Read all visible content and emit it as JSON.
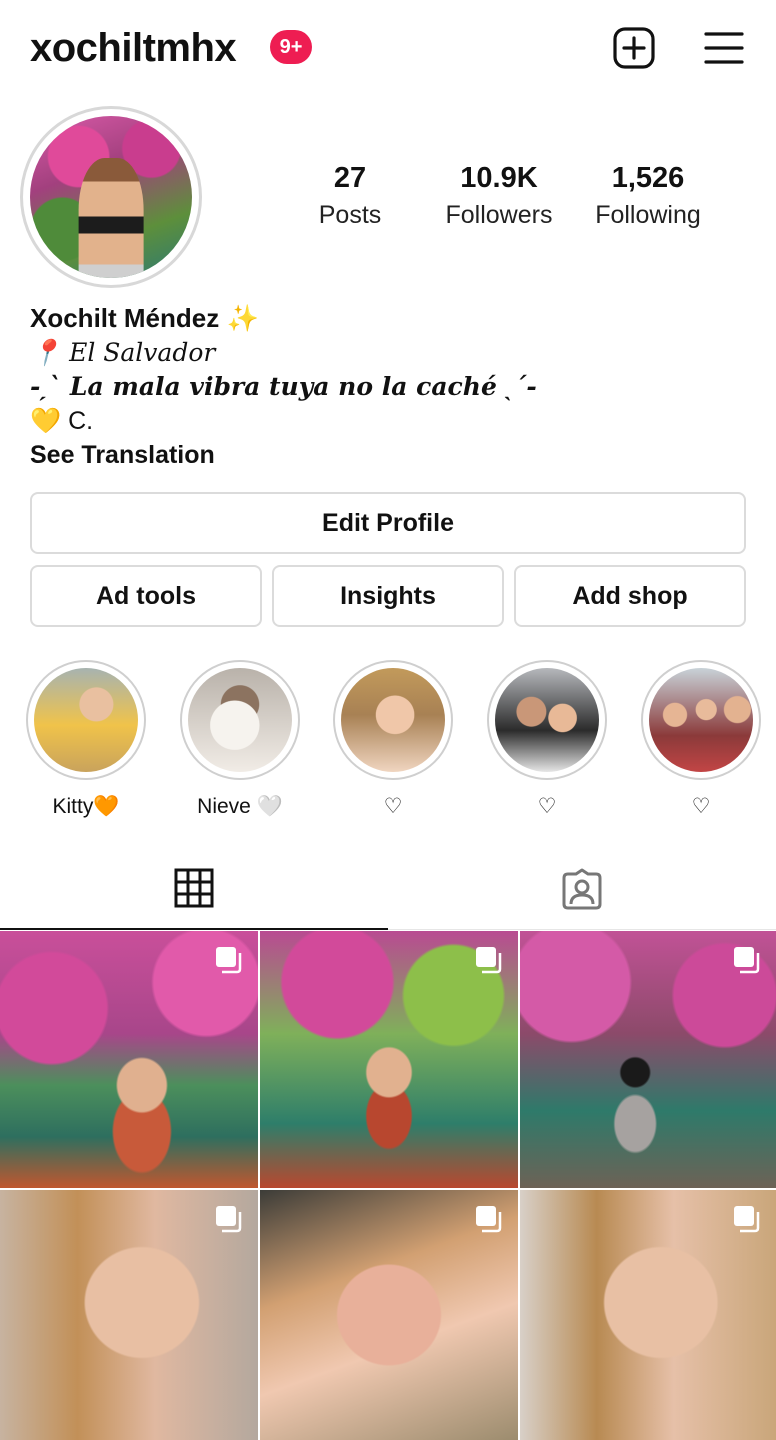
{
  "header": {
    "username": "xochiltmhx",
    "notification_badge": "9+",
    "add_icon": "plus-square-icon",
    "menu_icon": "hamburger-menu-icon"
  },
  "profile": {
    "stats": [
      {
        "value": "27",
        "label": "Posts"
      },
      {
        "value": "10.9K",
        "label": "Followers"
      },
      {
        "value": "1,526",
        "label": "Following"
      }
    ],
    "name": "Xochilt Méndez ✨",
    "bio_location": "📍 𝐸𝑙 𝑆𝑎𝑙𝑣𝑎𝑑𝑜𝑟",
    "bio_quote": "-͟͞ 𝙇𝙖 𝙢𝙖𝙡𝙖 𝙫𝙞𝙗𝙧𝙖 𝙩𝙪𝙮𝙖 𝙣𝙤 𝙡𝙖 𝙘𝙖𝙘𝙝é ͟͞-",
    "bio_quote_plain": "-ˏˋ La mala vibra tuya no la caché ˎˊ-",
    "bio_heart": "💛 C.",
    "see_translation": "See Translation"
  },
  "buttons": {
    "edit_profile": "Edit Profile",
    "ad_tools": "Ad tools",
    "insights": "Insights",
    "add_shop": "Add shop"
  },
  "highlights": [
    {
      "label": "Kitty🧡"
    },
    {
      "label": "Nieve 🤍"
    },
    {
      "label": "♡"
    },
    {
      "label": "♡"
    },
    {
      "label": "♡"
    }
  ],
  "tabs": [
    {
      "icon": "grid-icon",
      "active": true
    },
    {
      "icon": "tagged-person-icon",
      "active": false
    }
  ],
  "colors": {
    "badge": "#ee1d52",
    "border": "#dbdbdb",
    "text": "#111111"
  }
}
